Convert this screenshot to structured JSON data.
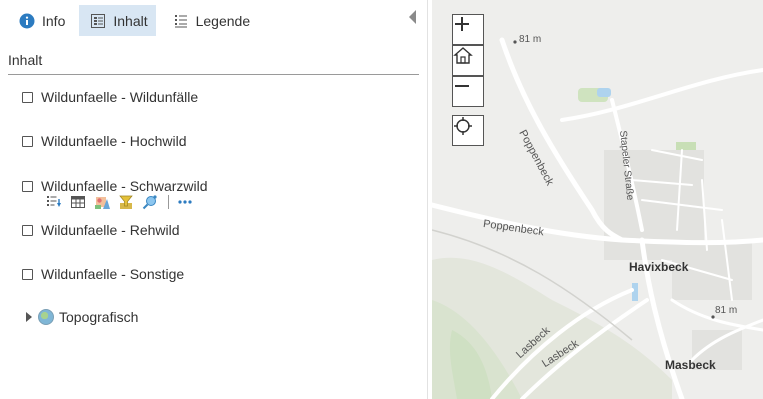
{
  "tabs": [
    {
      "label": "Info",
      "icon": "info-icon",
      "active": false
    },
    {
      "label": "Inhalt",
      "icon": "content-icon",
      "active": true
    },
    {
      "label": "Legende",
      "icon": "legend-icon",
      "active": false
    }
  ],
  "section_title": "Inhalt",
  "layers": [
    {
      "label": "Wildunfaelle - Wildunfälle",
      "checked": false
    },
    {
      "label": "Wildunfaelle - Hochwild",
      "checked": false
    },
    {
      "label": "Wildunfaelle - Schwarzwild",
      "checked": false
    },
    {
      "label": "Wildunfaelle - Rehwild",
      "checked": false
    },
    {
      "label": "Wildunfaelle - Sonstige",
      "checked": false
    }
  ],
  "layer_tools": [
    "show-legend-icon",
    "table-icon",
    "change-style-icon",
    "filter-icon",
    "analysis-icon",
    "more-options-icon"
  ],
  "basemap": {
    "label": "Topografisch",
    "icon": "basemap-globe-icon"
  },
  "map": {
    "controls": [
      "zoom-in-icon",
      "home-icon",
      "zoom-out-icon",
      "locate-icon"
    ],
    "labels": {
      "elev_top": "81 m",
      "elev_right": "81 m",
      "poppenbeck_vertical": "Poppenbeck",
      "stapeler": "Stapeler Straße",
      "poppenbeck_horizontal": "Poppenbeck",
      "lasbeck_1": "Lasbeck",
      "lasbeck_2": "Lasbeck",
      "havixbeck": "Havixbeck",
      "masbeck": "Masbeck"
    }
  },
  "colors": {
    "active_tab": "#d8e6f3",
    "info_blue": "#2c7bc0",
    "map_bg": "#eeeeec"
  }
}
